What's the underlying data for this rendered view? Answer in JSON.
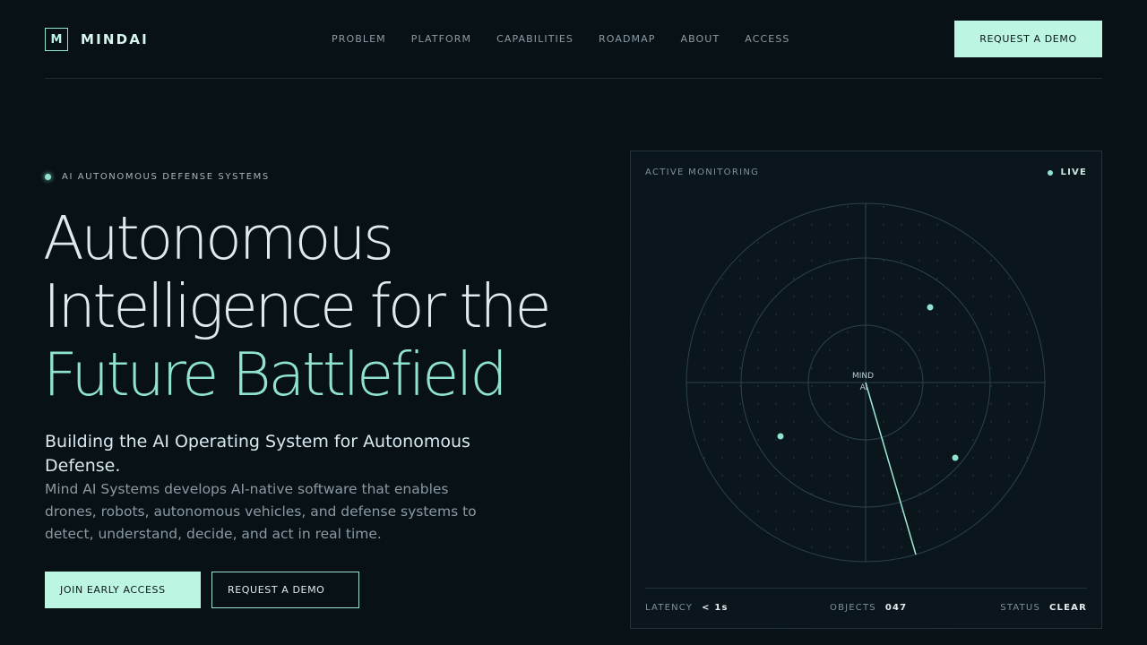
{
  "brand": {
    "mark": "M",
    "name": "MINDAI"
  },
  "nav": {
    "links": [
      "PROBLEM",
      "PLATFORM",
      "CAPABILITIES",
      "ROADMAP",
      "ABOUT",
      "ACCESS"
    ],
    "cta_label": "REQUEST A DEMO"
  },
  "hero": {
    "eyebrow": "AI AUTONOMOUS DEFENSE SYSTEMS",
    "headline_line1": "Autonomous",
    "headline_line2": "Intelligence for the",
    "headline_line3": "Future Battlefield",
    "subheadline": "Building the AI Operating System for Autonomous Defense.",
    "description": "Mind AI Systems develops AI-native software that enables drones, robots, autonomous vehicles, and defense systems to detect, understand, decide, and act in real time.",
    "primary_cta": "JOIN EARLY ACCESS",
    "secondary_cta": "REQUEST A DEMO"
  },
  "monitor": {
    "title": "ACTIVE MONITORING",
    "live_label": "LIVE",
    "center_label_line1": "MIND",
    "center_label_line2": "AI",
    "stats": {
      "latency_label": "LATENCY",
      "latency_value": "< 1s",
      "objects_label": "OBJECTS",
      "objects_value": "047",
      "status_label": "STATUS",
      "status_value": "CLEAR"
    }
  },
  "colors": {
    "background": "#071116",
    "accent": "#8fe3cf",
    "button_fill": "#bdf5e3",
    "panel": "#0a161b"
  }
}
